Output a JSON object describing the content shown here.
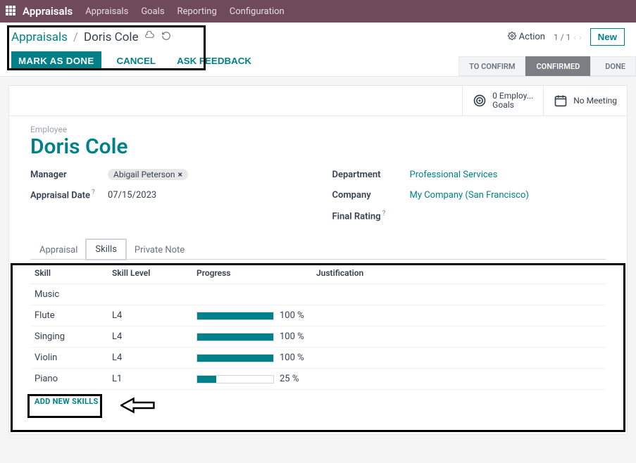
{
  "brand": {
    "app_title": "Appraisals",
    "nav": [
      "Appraisals",
      "Goals",
      "Reporting",
      "Configuration"
    ]
  },
  "toolbar": {
    "breadcrumb_root": "Appraisals",
    "breadcrumb_sep": "/",
    "breadcrumb_current": "Doris Cole",
    "action_label": "Action",
    "pager": "1 / 1",
    "new_label": "New",
    "mark_done": "MARK AS DONE",
    "cancel": "CANCEL",
    "ask_feedback": "ASK FEEDBACK"
  },
  "status": {
    "to_confirm": "TO CONFIRM",
    "confirmed": "CONFIRMED",
    "done": "DONE"
  },
  "smart": {
    "goals_top": "0 Employ...",
    "goals_bottom": "Goals",
    "meeting": "No Meeting"
  },
  "record": {
    "employee_label": "Employee",
    "employee_name": "Doris Cole",
    "manager_label": "Manager",
    "manager_value": "Abigail Peterson",
    "appraisal_date_label": "Appraisal Date",
    "appraisal_date_value": "07/15/2023",
    "department_label": "Department",
    "department_value": "Professional Services",
    "company_label": "Company",
    "company_value": "My Company (San Francisco)",
    "final_rating_label": "Final Rating"
  },
  "tabs": {
    "appraisal": "Appraisal",
    "skills": "Skills",
    "private_note": "Private Note"
  },
  "skills_table": {
    "headers": {
      "skill": "Skill",
      "level": "Skill Level",
      "progress": "Progress",
      "justification": "Justification"
    },
    "group": "Music",
    "rows": [
      {
        "skill": "Flute",
        "level": "L4",
        "progress": 100,
        "progress_label": "100 %"
      },
      {
        "skill": "Singing",
        "level": "L4",
        "progress": 100,
        "progress_label": "100 %"
      },
      {
        "skill": "Violin",
        "level": "L4",
        "progress": 100,
        "progress_label": "100 %"
      },
      {
        "skill": "Piano",
        "level": "L1",
        "progress": 25,
        "progress_label": "25 %"
      }
    ],
    "add_label": "ADD NEW SKILLS"
  }
}
